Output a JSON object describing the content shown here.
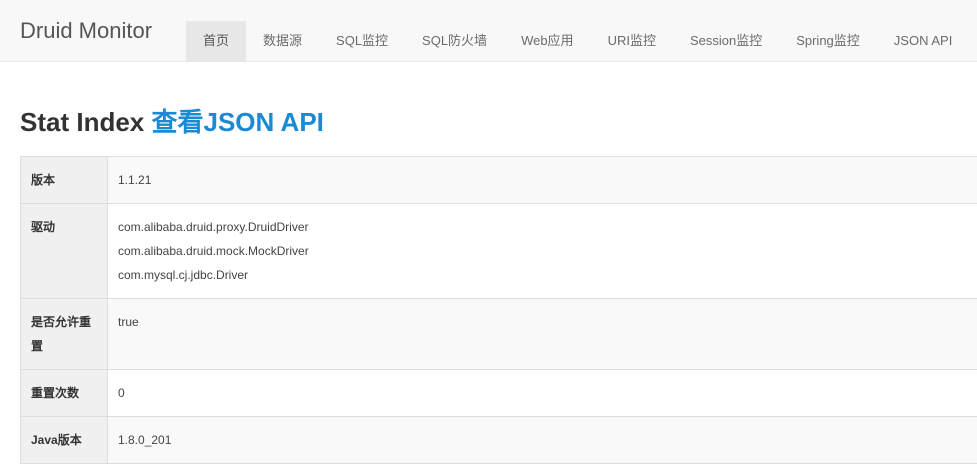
{
  "brand": "Druid Monitor",
  "nav": [
    {
      "label": "首页",
      "active": true
    },
    {
      "label": "数据源"
    },
    {
      "label": "SQL监控"
    },
    {
      "label": "SQL防火墙"
    },
    {
      "label": "Web应用"
    },
    {
      "label": "URI监控"
    },
    {
      "label": "Session监控"
    },
    {
      "label": "Spring监控"
    },
    {
      "label": "JSON API"
    }
  ],
  "title": {
    "text": "Stat Index",
    "link": "查看JSON API"
  },
  "stats": [
    {
      "label": "版本",
      "values": [
        "1.1.21"
      ]
    },
    {
      "label": "驱动",
      "values": [
        "com.alibaba.druid.proxy.DruidDriver",
        "com.alibaba.druid.mock.MockDriver",
        "com.mysql.cj.jdbc.Driver"
      ]
    },
    {
      "label": "是否允许重置",
      "values": [
        "true"
      ]
    },
    {
      "label": "重置次数",
      "values": [
        "0"
      ]
    },
    {
      "label": "Java版本",
      "values": [
        "1.8.0_201"
      ]
    }
  ]
}
